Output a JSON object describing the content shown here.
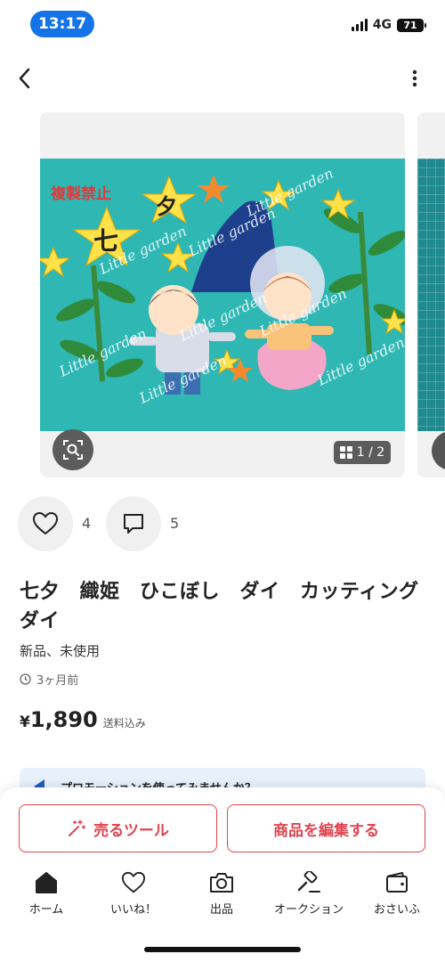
{
  "status_bar": {
    "time": "13:17",
    "network": "4G",
    "battery": "71"
  },
  "nav": {
    "back_icon": "chevron-left-icon",
    "more_icon": "more-vertical-icon"
  },
  "gallery": {
    "counter": "1 / 2",
    "watermark": "Little garden",
    "image_text": {
      "copy_notice": "複製禁止",
      "char1": "七",
      "char2": "夕"
    }
  },
  "reactions": {
    "likes": "4",
    "comments": "5"
  },
  "product": {
    "title": "七夕　織姫　ひこぼし　ダイ　カッティングダイ",
    "condition": "新品、未使用",
    "posted": "3ヶ月前",
    "price_symbol": "¥",
    "price": "1,890",
    "shipping": "送料込み"
  },
  "promo": {
    "text": "プロモーションを使ってみませんか？"
  },
  "actions": {
    "sell_tool": "売るツール",
    "edit_item": "商品を編集する"
  },
  "tabs": [
    {
      "label": "ホーム",
      "icon": "home-icon"
    },
    {
      "label": "いいね！",
      "icon": "heart-icon"
    },
    {
      "label": "出品",
      "icon": "camera-icon"
    },
    {
      "label": "オークション",
      "icon": "gavel-icon"
    },
    {
      "label": "おさいふ",
      "icon": "wallet-icon"
    }
  ],
  "colors": {
    "accent": "#e04450",
    "time_pill": "#1473e6",
    "image_bg": "#2fb7b4"
  }
}
